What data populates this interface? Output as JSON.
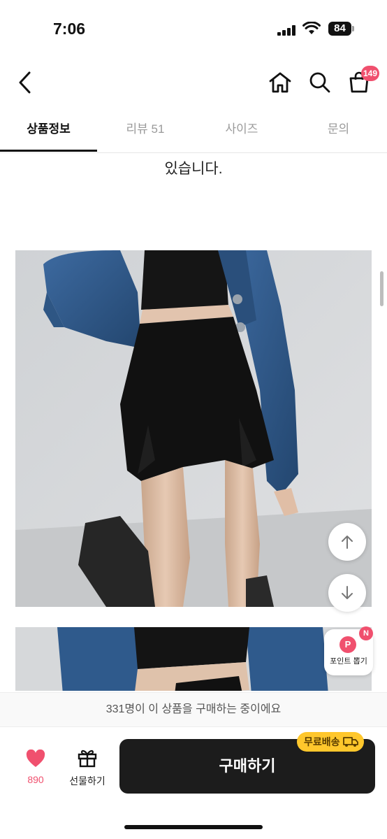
{
  "status_bar": {
    "time": "7:06",
    "battery": "84"
  },
  "header": {
    "cart_count": "149"
  },
  "tabs": [
    {
      "label": "상품정보"
    },
    {
      "label": "리뷰 51"
    },
    {
      "label": "사이즈"
    },
    {
      "label": "문의"
    }
  ],
  "description": {
    "text_tail": "있습니다."
  },
  "floating": {
    "point_badge": "P",
    "point_new": "N",
    "point_label": "포인트 뽑기"
  },
  "bottom": {
    "buyers_notice": "331명이 이 상품을 구매하는 중이에요",
    "like_count": "890",
    "gift_label": "선물하기",
    "buy_label": "구매하기",
    "free_shipping": "무료배송"
  },
  "colors": {
    "accent": "#f0506e",
    "buy_button": "#1c1c1c",
    "shipping_badge": "#ffc72c"
  }
}
